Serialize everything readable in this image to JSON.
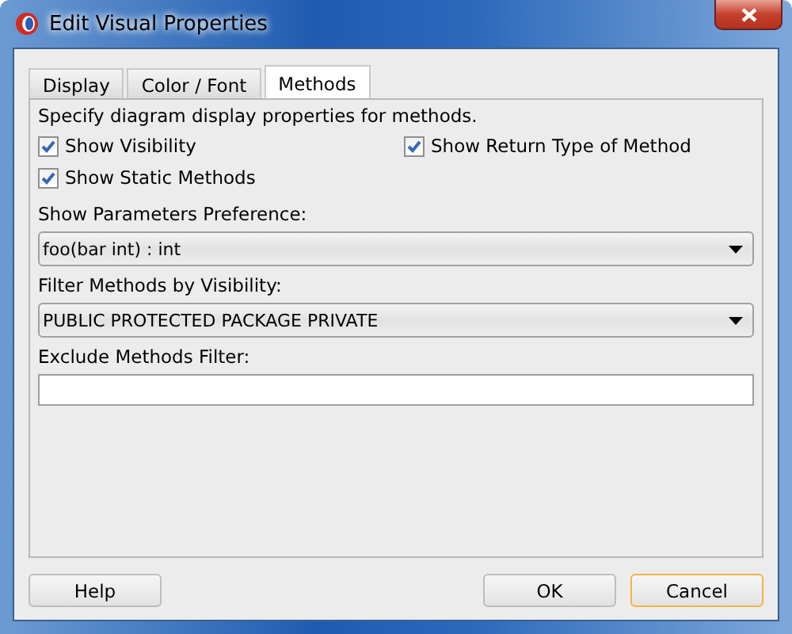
{
  "window": {
    "title": "Edit Visual Properties"
  },
  "tabs": [
    {
      "label": "Display",
      "selected": false
    },
    {
      "label": "Color / Font",
      "selected": false
    },
    {
      "label": "Methods",
      "selected": true
    }
  ],
  "description": "Specify diagram display properties for methods.",
  "checkboxes": [
    {
      "label": "Show Visibility",
      "checked": true
    },
    {
      "label": "Show Return Type of Method",
      "checked": true
    },
    {
      "label": "Show Static Methods",
      "checked": true
    }
  ],
  "fields": [
    {
      "kind": "dropdown",
      "label": "Show Parameters Preference:",
      "value": "foo(bar int) : int"
    },
    {
      "kind": "dropdown",
      "label": "Filter Methods by Visibility:",
      "value": "PUBLIC PROTECTED PACKAGE PRIVATE"
    },
    {
      "kind": "text",
      "label": "Exclude Methods Filter:"
    }
  ],
  "buttons": [
    {
      "label": "Help",
      "focused": false
    },
    {
      "label": "OK",
      "focused": false
    },
    {
      "label": "Cancel",
      "focused": true
    }
  ]
}
